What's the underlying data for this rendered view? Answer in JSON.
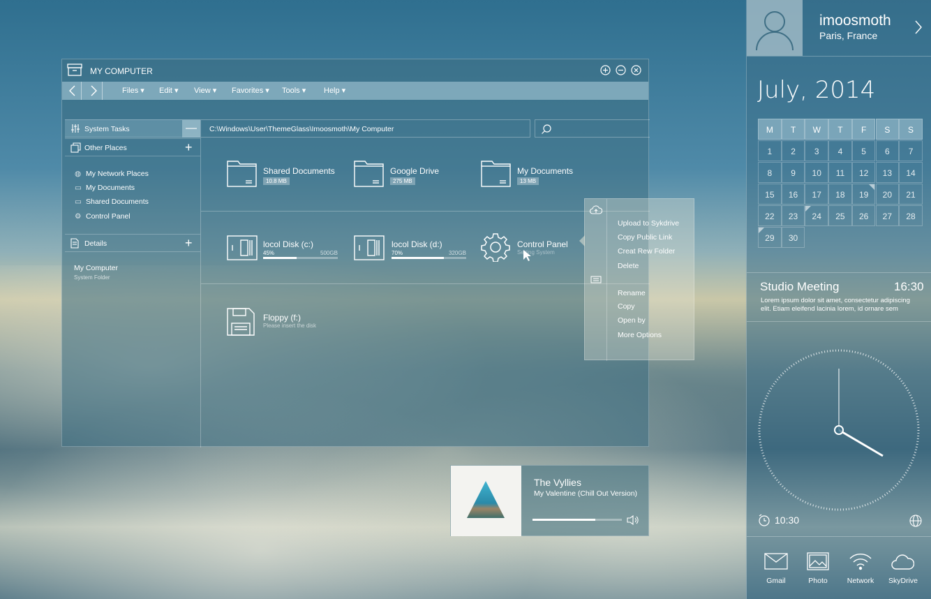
{
  "window": {
    "title": "MY COMPUTER",
    "menu": [
      "Files ▾",
      "Edit ▾",
      "View ▾",
      "Favorites ▾",
      "Tools ▾",
      "Help ▾"
    ],
    "address": "C:\\Windows\\User\\ThemeGlass\\Imoosmoth\\My Computer"
  },
  "sidebar": {
    "system_tasks": "System Tasks",
    "other_places": "Other Places",
    "links": [
      "My Network Places",
      "My Documents",
      "Shared Documents",
      "Control Panel"
    ],
    "details": "Details",
    "detail_title": "My Computer",
    "detail_sub": "System Folder"
  },
  "items": {
    "shared": {
      "name": "Shared Documents",
      "size": "10.8 MB"
    },
    "gdrive": {
      "name": "Google Drive",
      "size": "275 MB"
    },
    "mydocs": {
      "name": "My Documents",
      "size": "13 MB"
    },
    "diskc": {
      "name": "locol Disk (c:)",
      "used": "45%",
      "total": "500GB",
      "fraction": 0.45
    },
    "diskd": {
      "name": "locol Disk (d:)",
      "used": "70%",
      "total": "320GB",
      "fraction": 0.7
    },
    "cpanel": {
      "name": "Control Panel",
      "sub": "Setting System"
    },
    "floppy": {
      "name": "Floppy (f:)",
      "sub": "Please insert the disk"
    }
  },
  "context_menu": [
    "Upload to Sykdrive",
    "Copy Public Link",
    "Creat Rew Folder",
    "Delete",
    "Rename",
    "Copy",
    "Open by",
    "More Options"
  ],
  "user": {
    "name": "imoosmoth",
    "location": "Paris, France"
  },
  "calendar": {
    "month": "July, 2014",
    "days": [
      "M",
      "T",
      "W",
      "T",
      "F",
      "S",
      "S"
    ],
    "dates": [
      [
        "1",
        "2",
        "3",
        "4",
        "5",
        "6",
        "7"
      ],
      [
        "8",
        "9",
        "10",
        "11",
        "12",
        "13",
        "14"
      ],
      [
        "15",
        "16",
        "17",
        "18",
        "19",
        "20",
        "21"
      ],
      [
        "22",
        "23",
        "24",
        "25",
        "26",
        "27",
        "28"
      ],
      [
        "29",
        "30"
      ]
    ]
  },
  "event": {
    "title": "Studio Meeting",
    "time": "16:30",
    "desc1": "Lorem ipsum dolor sit amet, consectetur adipiscing",
    "desc2": "elit. Etiam eleifend lacinia lorem, id ornare sem"
  },
  "alarm": "10:30",
  "dock": [
    "Gmail",
    "Photo",
    "Network",
    "SkyDrive"
  ],
  "music": {
    "artist": "The Vyllies",
    "track": "My Valentine (Chill Out Version)",
    "progress": 0.7
  }
}
